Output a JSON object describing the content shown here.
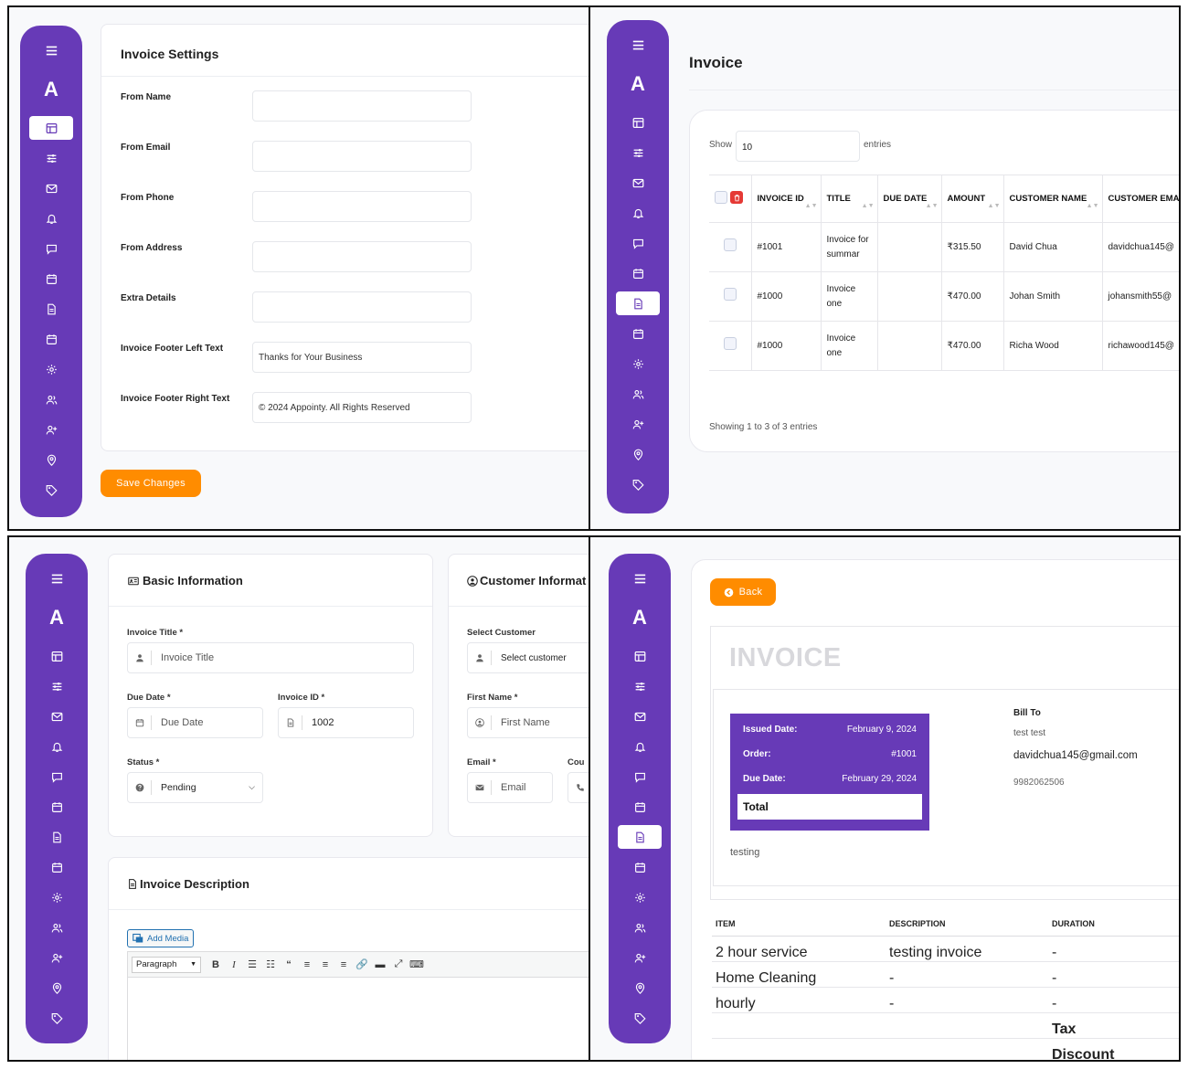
{
  "sidebar": {
    "logo": "A"
  },
  "settings": {
    "title": "Invoice Settings",
    "fields": [
      {
        "label": "From Name",
        "value": ""
      },
      {
        "label": "From Email",
        "value": ""
      },
      {
        "label": "From Phone",
        "value": ""
      },
      {
        "label": "From Address",
        "value": ""
      },
      {
        "label": "Extra Details",
        "value": ""
      },
      {
        "label": "Invoice Footer Left Text",
        "value": "Thanks for Your Business"
      },
      {
        "label": "Invoice Footer Right Text",
        "value": "© 2024 Appointy. All Rights Reserved"
      }
    ],
    "save_label": "Save Changes"
  },
  "invoice_list": {
    "title": "Invoice",
    "show_label": "Show",
    "show_value": "10",
    "entries_label": "entries",
    "columns": [
      "INVOICE ID",
      "TITLE",
      "DUE DATE",
      "AMOUNT",
      "CUSTOMER NAME",
      "CUSTOMER EMAIL"
    ],
    "rows": [
      {
        "id": "#1001",
        "title": "Invoice for summar",
        "due": "",
        "amount": "₹315.50",
        "name": "David Chua",
        "email": "davidchua145@"
      },
      {
        "id": "#1000",
        "title": "Invoice one",
        "due": "",
        "amount": "₹470.00",
        "name": "Johan Smith",
        "email": "johansmith55@"
      },
      {
        "id": "#1000",
        "title": "Invoice one",
        "due": "",
        "amount": "₹470.00",
        "name": "Richa Wood",
        "email": "richawood145@"
      }
    ],
    "footer": "Showing 1 to 3 of 3 entries"
  },
  "create": {
    "basic_title": "Basic Information",
    "customer_title": "Customer Informat",
    "invoice_title_label": "Invoice Title *",
    "invoice_title_placeholder": "Invoice Title",
    "due_date_label": "Due Date *",
    "due_date_placeholder": "Due Date",
    "invoice_id_label": "Invoice ID *",
    "invoice_id_value": "1002",
    "status_label": "Status *",
    "status_value": "Pending",
    "select_customer_label": "Select Customer",
    "select_customer_placeholder": "Select customer",
    "first_name_label": "First Name *",
    "first_name_placeholder": "First Name",
    "email_label": "Email *",
    "email_placeholder": "Email",
    "country_label": "Cou",
    "desc_title": "Invoice Description",
    "add_media": "Add Media",
    "paragraph": "Paragraph"
  },
  "view": {
    "back_label": "Back",
    "heading": "INVOICE",
    "issued_label": "Issued Date:",
    "issued_value": "February 9, 2024",
    "order_label": "Order:",
    "order_value": "#1001",
    "due_label": "Due Date:",
    "due_value": "February 29, 2024",
    "total_label": "Total",
    "bill_to_label": "Bill To",
    "bill_name": "test test",
    "bill_email": "davidchua145@gmail.com",
    "bill_phone": "9982062506",
    "note": "testing",
    "item_headers": [
      "ITEM",
      "DESCRIPTION",
      "DURATION"
    ],
    "items": [
      {
        "item": "2 hour service",
        "description": "testing invoice",
        "duration": "-"
      },
      {
        "item": "Home Cleaning",
        "description": "-",
        "duration": "-"
      },
      {
        "item": "hourly",
        "description": "-",
        "duration": "-"
      }
    ],
    "tax_label": "Tax",
    "discount_label": "Discount"
  },
  "colors": {
    "sidebar": "#673ab7",
    "accent": "#ff8c00",
    "danger": "#e53935"
  }
}
